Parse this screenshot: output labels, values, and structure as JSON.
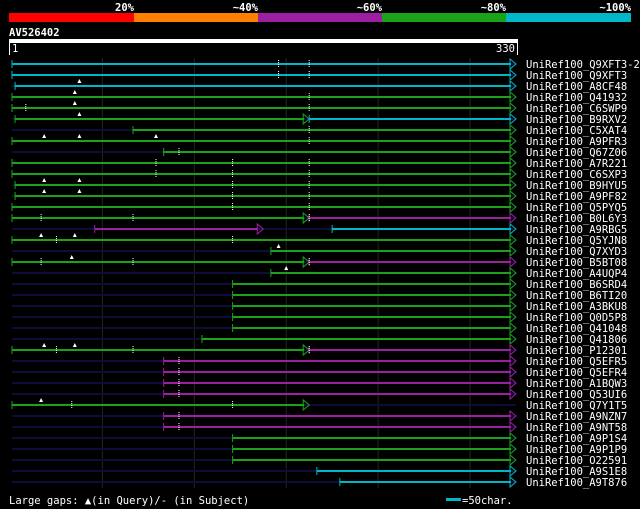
{
  "colors": {
    "background": "#000000",
    "scale_20": "#ff0000",
    "scale_40": "#ff7f00",
    "scale_60": "#9b1fa0",
    "scale_80": "#1aa31a",
    "scale_100": "#00b7c8",
    "grid": "#2a2a2a",
    "text": "#ffffff",
    "query_bar": "#ffffff",
    "gap_marker": "#ffffff"
  },
  "legend": {
    "scale": [
      {
        "label": "20%",
        "color": "#ff0000"
      },
      {
        "label": "~40%",
        "color": "#ff7f00"
      },
      {
        "label": "~60%",
        "color": "#9b1fa0"
      },
      {
        "label": "~80%",
        "color": "#1aa31a"
      },
      {
        "label": "~100%",
        "color": "#00b7c8"
      }
    ],
    "footer_gaps": "Large gaps: ▲(in Query)/- (in Subject)",
    "footer_scale": "=50char."
  },
  "query": {
    "name": "AV526402",
    "start_label": "1",
    "end_label": "330",
    "length": 330
  },
  "chart_data": {
    "type": "alignment",
    "query_length": 330,
    "hits": [
      {
        "name": "UniRef100_Q9XFT3-2",
        "color": "cyan",
        "segments": [
          [
            1,
            330
          ]
        ],
        "query_gaps": [],
        "subject_gaps": [
          175,
          195
        ]
      },
      {
        "name": "UniRef100_Q9XFT3",
        "color": "cyan",
        "segments": [
          [
            1,
            330
          ]
        ],
        "query_gaps": [],
        "subject_gaps": [
          175,
          195
        ]
      },
      {
        "name": "UniRef100_A8CF48",
        "color": "cyan",
        "segments": [
          [
            3,
            330
          ]
        ],
        "query_gaps": [
          45
        ],
        "subject_gaps": []
      },
      {
        "name": "UniRef100_Q41932",
        "color": "green",
        "segments": [
          [
            1,
            330
          ]
        ],
        "query_gaps": [
          42
        ],
        "subject_gaps": [
          195
        ]
      },
      {
        "name": "UniRef100_C6SWP9",
        "color": "green",
        "segments": [
          [
            1,
            330
          ]
        ],
        "query_gaps": [
          42
        ],
        "subject_gaps": [
          10,
          195
        ]
      },
      {
        "name": "UniRef100_B9RXV2",
        "color": "green",
        "segments": [
          [
            3,
            195
          ]
        ],
        "query_gaps": [
          45
        ],
        "subject_gaps": [],
        "extra": {
          "color": "cyan",
          "range": [
            195,
            330
          ]
        }
      },
      {
        "name": "UniRef100_C5XAT4",
        "color": "green",
        "segments": [
          [
            80,
            330
          ]
        ],
        "query_gaps": [],
        "subject_gaps": [
          195
        ]
      },
      {
        "name": "UniRef100_A9PFR3",
        "color": "green",
        "segments": [
          [
            1,
            330
          ]
        ],
        "query_gaps": [
          22,
          45,
          95
        ],
        "subject_gaps": [
          195
        ]
      },
      {
        "name": "UniRef100_Q67Z06",
        "color": "green",
        "segments": [
          [
            100,
            330
          ]
        ],
        "query_gaps": [],
        "subject_gaps": [
          110
        ]
      },
      {
        "name": "UniRef100_A7R221",
        "color": "green",
        "segments": [
          [
            1,
            330
          ]
        ],
        "query_gaps": [],
        "subject_gaps": [
          95,
          145,
          195
        ]
      },
      {
        "name": "UniRef100_C6SXP3",
        "color": "green",
        "segments": [
          [
            1,
            330
          ]
        ],
        "query_gaps": [],
        "subject_gaps": [
          95,
          145,
          195
        ]
      },
      {
        "name": "UniRef100_B9HYU5",
        "color": "green",
        "segments": [
          [
            3,
            330
          ]
        ],
        "query_gaps": [
          22,
          45
        ],
        "subject_gaps": [
          145,
          195
        ]
      },
      {
        "name": "UniRef100_A9PF82",
        "color": "green",
        "segments": [
          [
            3,
            330
          ]
        ],
        "query_gaps": [
          22,
          45
        ],
        "subject_gaps": [
          145,
          195
        ]
      },
      {
        "name": "UniRef100_Q5PYQ5",
        "color": "green",
        "segments": [
          [
            1,
            330
          ]
        ],
        "query_gaps": [],
        "subject_gaps": [
          145,
          195
        ]
      },
      {
        "name": "UniRef100_B0L6Y3",
        "color": "green",
        "segments": [
          [
            1,
            195
          ]
        ],
        "query_gaps": [],
        "subject_gaps": [
          20,
          80,
          195
        ],
        "extra": {
          "color": "purple",
          "range": [
            195,
            330
          ]
        }
      },
      {
        "name": "UniRef100_A9RBG5",
        "color": "purple",
        "segments": [
          [
            55,
            165
          ]
        ],
        "query_gaps": [],
        "subject_gaps": [],
        "extra": {
          "color": "cyan",
          "range": [
            210,
            330
          ]
        }
      },
      {
        "name": "UniRef100_Q5YJN8",
        "color": "green",
        "segments": [
          [
            1,
            330
          ]
        ],
        "query_gaps": [
          20,
          42
        ],
        "subject_gaps": [
          30,
          145
        ]
      },
      {
        "name": "UniRef100_Q7XYD3",
        "color": "green",
        "segments": [
          [
            170,
            330
          ]
        ],
        "query_gaps": [
          175
        ],
        "subject_gaps": []
      },
      {
        "name": "UniRef100_B5BT08",
        "color": "green",
        "segments": [
          [
            1,
            195
          ]
        ],
        "query_gaps": [
          40
        ],
        "subject_gaps": [
          20,
          80,
          195
        ],
        "extra": {
          "color": "purple",
          "range": [
            195,
            330
          ]
        }
      },
      {
        "name": "UniRef100_A4UQP4",
        "color": "green",
        "segments": [
          [
            170,
            330
          ]
        ],
        "query_gaps": [
          180
        ],
        "subject_gaps": []
      },
      {
        "name": "UniRef100_B6SRD4",
        "color": "green",
        "segments": [
          [
            145,
            330
          ]
        ],
        "query_gaps": [],
        "subject_gaps": []
      },
      {
        "name": "UniRef100_B6TI20",
        "color": "green",
        "segments": [
          [
            145,
            330
          ]
        ],
        "query_gaps": [],
        "subject_gaps": []
      },
      {
        "name": "UniRef100_A3BKU8",
        "color": "green",
        "segments": [
          [
            145,
            330
          ]
        ],
        "query_gaps": [],
        "subject_gaps": []
      },
      {
        "name": "UniRef100_Q0D5P8",
        "color": "green",
        "segments": [
          [
            145,
            330
          ]
        ],
        "query_gaps": [],
        "subject_gaps": []
      },
      {
        "name": "UniRef100_Q41048",
        "color": "green",
        "segments": [
          [
            145,
            330
          ]
        ],
        "query_gaps": [],
        "subject_gaps": []
      },
      {
        "name": "UniRef100_Q41806",
        "color": "green",
        "segments": [
          [
            125,
            330
          ]
        ],
        "query_gaps": [],
        "subject_gaps": []
      },
      {
        "name": "UniRef100_P12301",
        "color": "green",
        "segments": [
          [
            1,
            195
          ]
        ],
        "query_gaps": [
          22,
          42
        ],
        "subject_gaps": [
          30,
          80,
          195
        ],
        "extra": {
          "color": "purple",
          "range": [
            195,
            330
          ]
        }
      },
      {
        "name": "UniRef100_Q5EFR5",
        "color": "purple",
        "segments": [
          [
            100,
            330
          ]
        ],
        "query_gaps": [],
        "subject_gaps": [
          110
        ]
      },
      {
        "name": "UniRef100_Q5EFR4",
        "color": "purple",
        "segments": [
          [
            100,
            330
          ]
        ],
        "query_gaps": [],
        "subject_gaps": [
          110
        ]
      },
      {
        "name": "UniRef100_A1BQW3",
        "color": "purple",
        "segments": [
          [
            100,
            330
          ]
        ],
        "query_gaps": [],
        "subject_gaps": [
          110
        ]
      },
      {
        "name": "UniRef100_Q53UI6",
        "color": "purple",
        "segments": [
          [
            100,
            330
          ]
        ],
        "query_gaps": [],
        "subject_gaps": [
          110
        ]
      },
      {
        "name": "UniRef100_Q7Y1T5",
        "color": "green",
        "segments": [
          [
            1,
            195
          ]
        ],
        "query_gaps": [
          20
        ],
        "subject_gaps": [
          40,
          145
        ],
        "extra": null
      },
      {
        "name": "UniRef100_A9NZN7",
        "color": "purple",
        "segments": [
          [
            100,
            330
          ]
        ],
        "query_gaps": [],
        "subject_gaps": [
          110
        ]
      },
      {
        "name": "UniRef100_A9NT58",
        "color": "purple",
        "segments": [
          [
            100,
            330
          ]
        ],
        "query_gaps": [],
        "subject_gaps": [
          110
        ]
      },
      {
        "name": "UniRef100_A9P1S4",
        "color": "green",
        "segments": [
          [
            145,
            330
          ]
        ],
        "query_gaps": [],
        "subject_gaps": []
      },
      {
        "name": "UniRef100_A9P1P9",
        "color": "green",
        "segments": [
          [
            145,
            330
          ]
        ],
        "query_gaps": [],
        "subject_gaps": []
      },
      {
        "name": "UniRef100_O22591",
        "color": "green",
        "segments": [
          [
            145,
            330
          ]
        ],
        "query_gaps": [],
        "subject_gaps": []
      },
      {
        "name": "UniRef100_A9S1E8",
        "color": "cyan",
        "segments": [
          [
            200,
            330
          ]
        ],
        "query_gaps": [],
        "subject_gaps": []
      },
      {
        "name": "UniRef100_A9T876",
        "color": "cyan",
        "segments": [
          [
            215,
            330
          ]
        ],
        "query_gaps": [],
        "subject_gaps": []
      }
    ]
  }
}
